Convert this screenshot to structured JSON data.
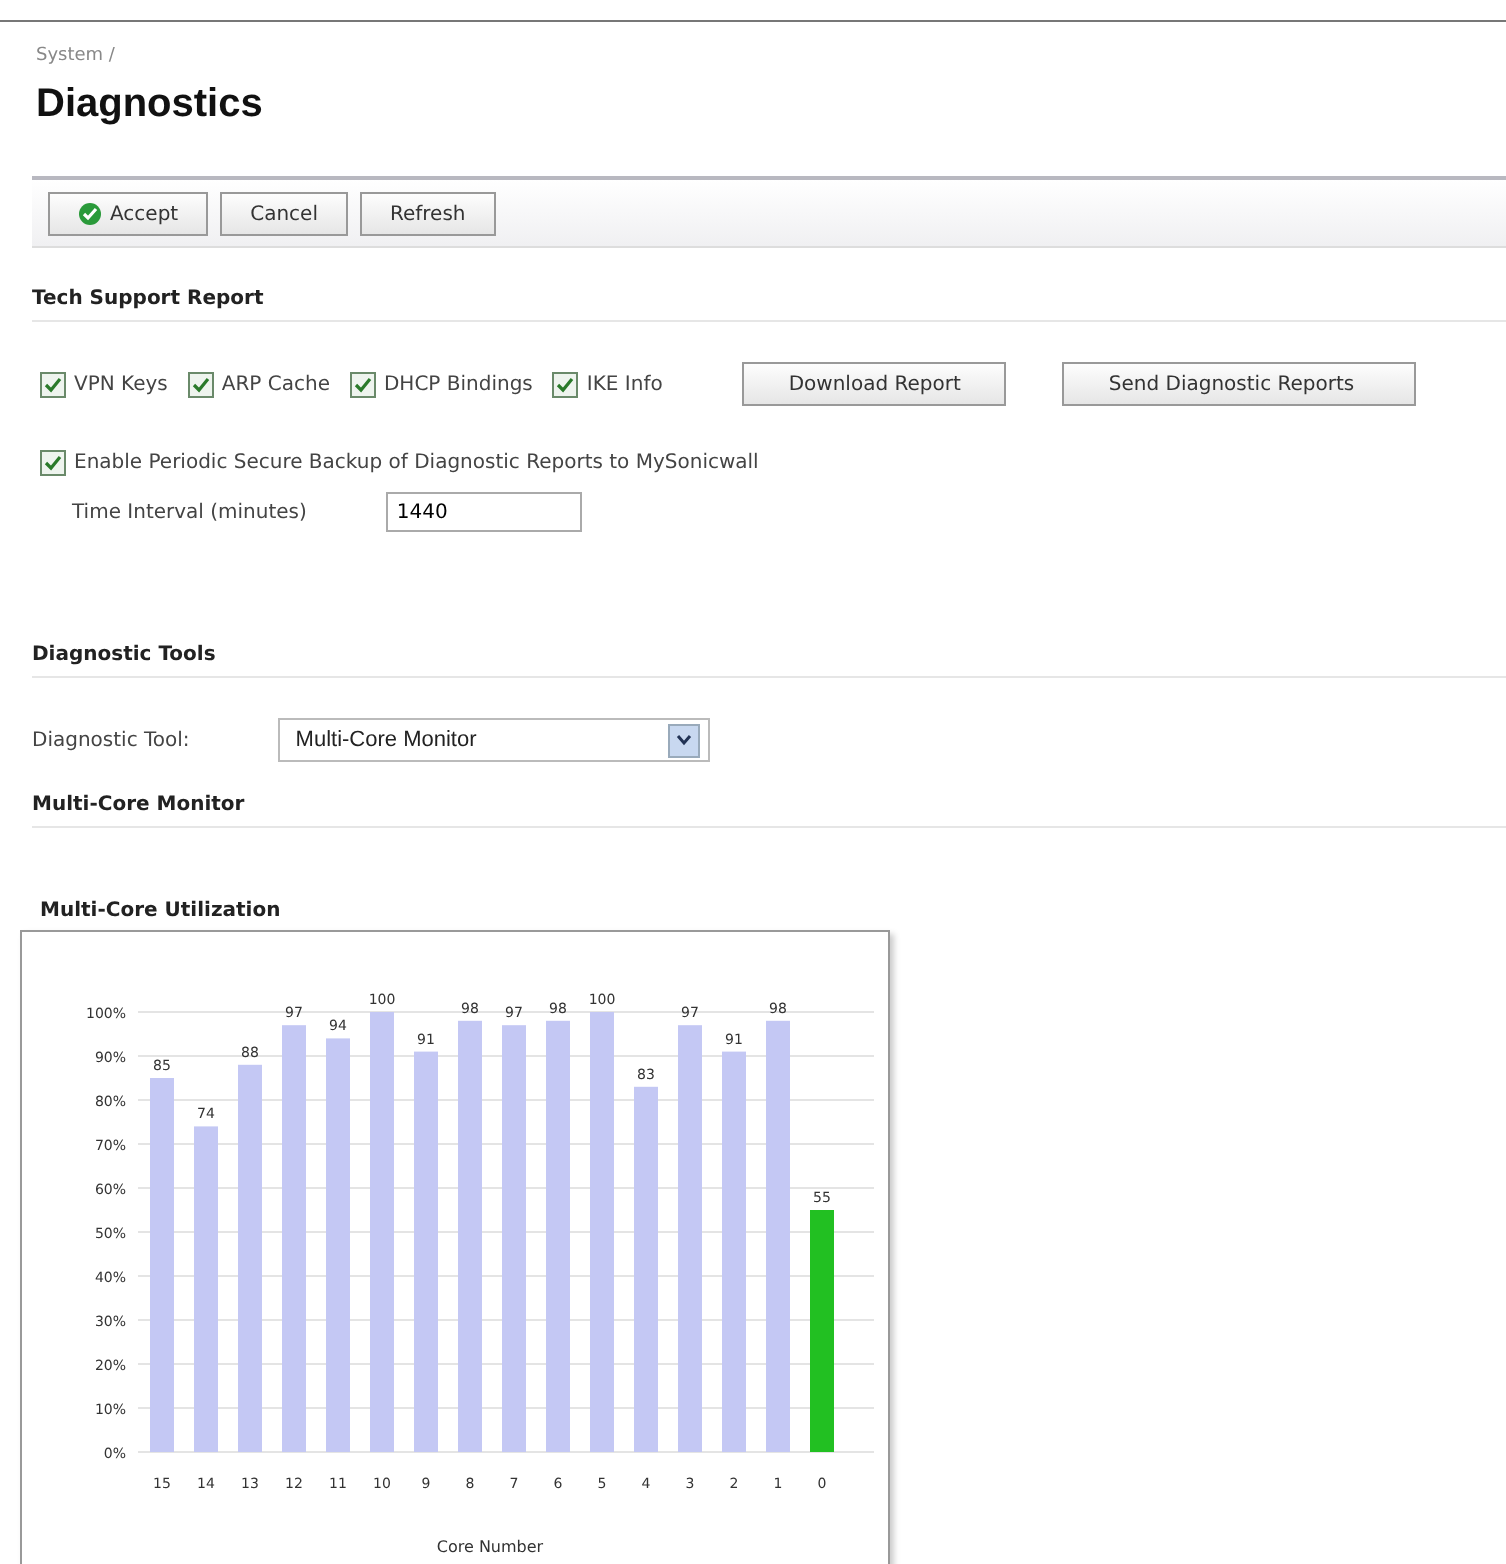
{
  "breadcrumb": "System /",
  "title": "Diagnostics",
  "toolbar": [
    {
      "label": "Accept",
      "kind": "accept"
    },
    {
      "label": "Cancel",
      "kind": "plain"
    },
    {
      "label": "Refresh",
      "kind": "plain"
    }
  ],
  "tech_support": {
    "heading": "Tech Support Report",
    "options": [
      {
        "label": "VPN Keys",
        "checked": true
      },
      {
        "label": "ARP Cache",
        "checked": true
      },
      {
        "label": "DHCP Bindings",
        "checked": true
      },
      {
        "label": "IKE Info",
        "checked": true
      }
    ],
    "buttons": [
      "Download Report",
      "Send Diagnostic Reports"
    ],
    "backup": {
      "label": "Enable Periodic Secure Backup of Diagnostic Reports to MySonicwall",
      "checked": true
    },
    "interval": {
      "label": "Time Interval (minutes)",
      "value": "1440"
    }
  },
  "diagnostic_tools": {
    "heading": "Diagnostic Tools",
    "label": "Diagnostic Tool:",
    "value": "Multi-Core Monitor"
  },
  "monitor": {
    "heading": "Multi-Core Monitor",
    "chart_title": "Multi-Core Utilization",
    "chart_data": {
      "type": "bar",
      "xlabel": "Core Number",
      "categories": [
        "15",
        "14",
        "13",
        "12",
        "11",
        "10",
        "9",
        "8",
        "7",
        "6",
        "5",
        "4",
        "3",
        "2",
        "1",
        "0"
      ],
      "series": [
        {
          "color": "#c4c8f4",
          "values": [
            85,
            74,
            88,
            97,
            94,
            100,
            91,
            98,
            97,
            98,
            100,
            83,
            97,
            91,
            98,
            null
          ]
        },
        {
          "color": "#22c022",
          "values": [
            null,
            null,
            null,
            null,
            null,
            null,
            null,
            null,
            null,
            null,
            null,
            null,
            null,
            null,
            null,
            55
          ]
        }
      ],
      "grid": true,
      "ylim": [
        0,
        100
      ],
      "yticks": [
        {
          "value": 0,
          "label": "0%"
        },
        {
          "value": 10,
          "label": "10%"
        },
        {
          "value": 20,
          "label": "20%"
        },
        {
          "value": 30,
          "label": "30%"
        },
        {
          "value": 40,
          "label": "40%"
        },
        {
          "value": 50,
          "label": "50%"
        },
        {
          "value": 60,
          "label": "60%"
        },
        {
          "value": 70,
          "label": "70%"
        },
        {
          "value": 80,
          "label": "80%"
        },
        {
          "value": 90,
          "label": "90%"
        },
        {
          "value": 100,
          "label": "100%"
        }
      ],
      "data_labels": true
    }
  }
}
